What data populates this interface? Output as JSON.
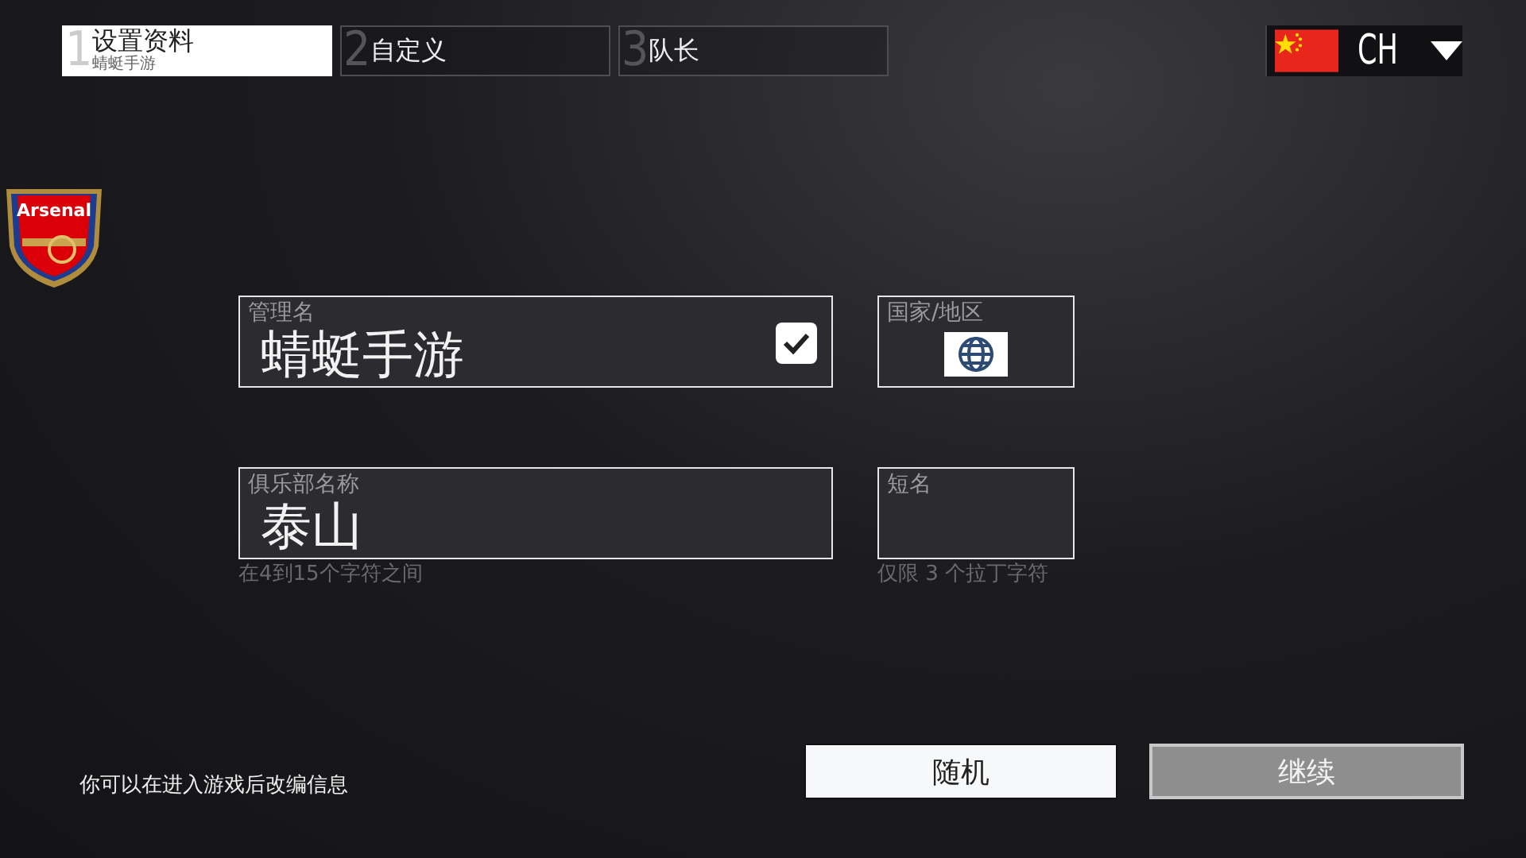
{
  "tabs": [
    {
      "number": "1",
      "label": "设置资料",
      "sublabel": "蜻蜓手游",
      "selected": true
    },
    {
      "number": "2",
      "label": "自定义",
      "selected": false
    },
    {
      "number": "3",
      "label": "队长",
      "selected": false
    }
  ],
  "language": {
    "code": "CH"
  },
  "club_badge": {
    "text": "Arsenal"
  },
  "fields": [
    {
      "kind": "text",
      "label": "管理名",
      "value": "蜻蜓手游",
      "checked": true
    },
    {
      "kind": "country",
      "label": "国家/地区"
    },
    {
      "kind": "text",
      "label": "俱乐部名称",
      "value": "泰山",
      "hint": "在4到15个字符之间"
    },
    {
      "kind": "text",
      "label": "短名",
      "hint": "仅限 3 个拉丁字符"
    }
  ],
  "footer_note": "你可以在进入游戏后改编信息",
  "buttons": [
    {
      "label": "随机",
      "disabled": false
    },
    {
      "label": "继续",
      "disabled": true
    }
  ]
}
